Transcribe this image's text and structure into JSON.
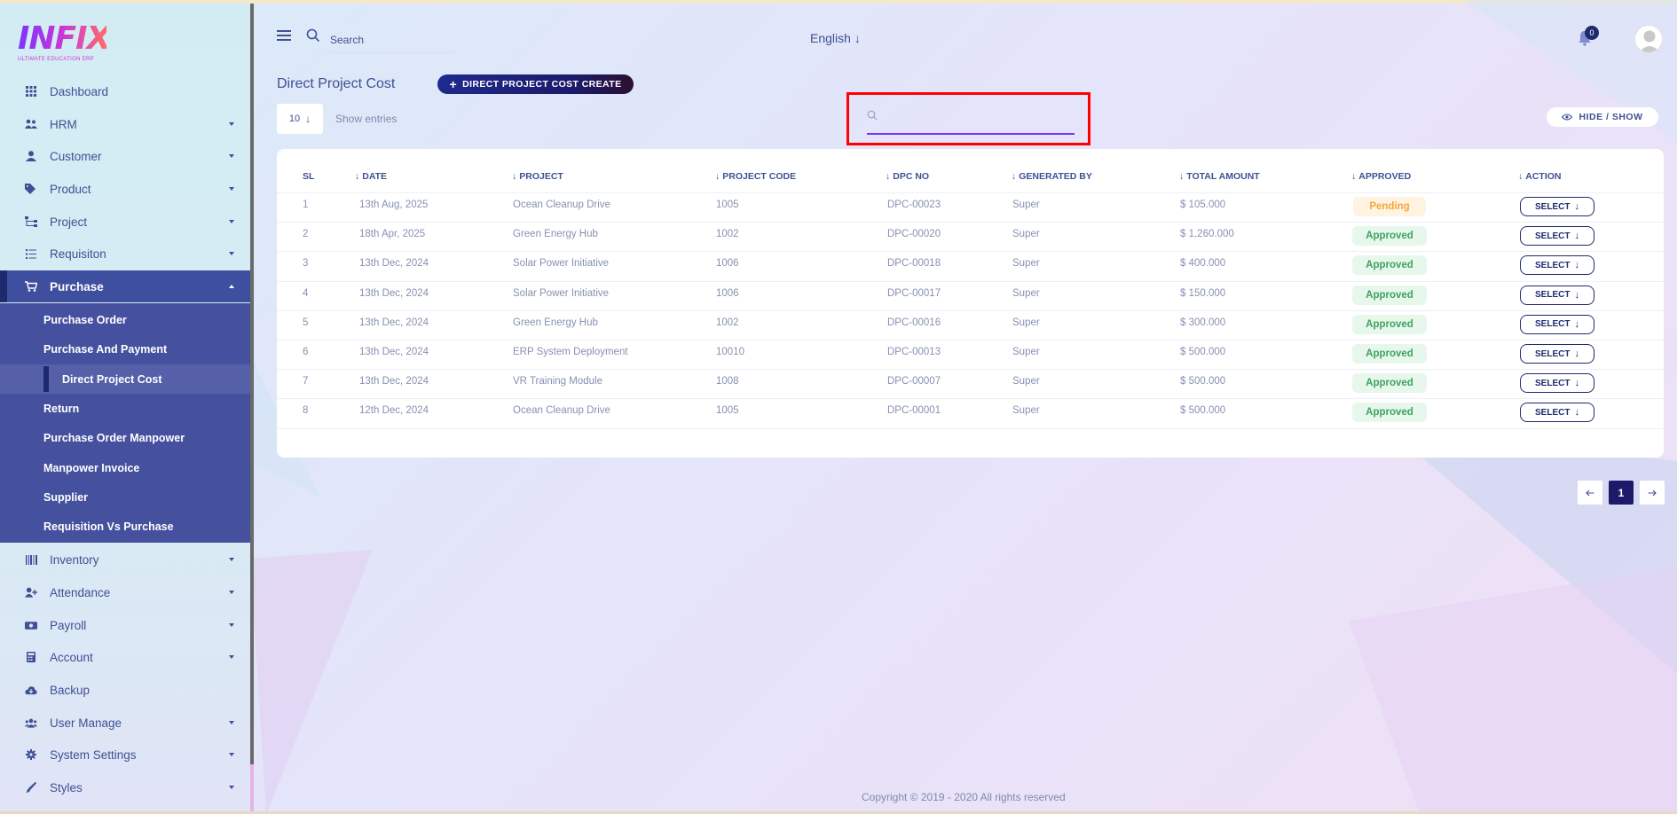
{
  "app": {
    "logo": "INFIX",
    "logo_sub": "ULTIMATE EDUCATION ERP"
  },
  "header": {
    "search_placeholder": "Search",
    "language": "English",
    "notification_count": "0"
  },
  "sidebar": {
    "items": [
      {
        "label": "Dashboard",
        "icon": "grid-icon"
      },
      {
        "label": "HRM",
        "icon": "people-icon"
      },
      {
        "label": "Customer",
        "icon": "user-icon"
      },
      {
        "label": "Product",
        "icon": "tags-icon"
      },
      {
        "label": "Project",
        "icon": "sitemap-icon"
      },
      {
        "label": "Requisiton",
        "icon": "list-icon"
      },
      {
        "label": "Purchase",
        "icon": "cart-icon"
      },
      {
        "label": "Inventory",
        "icon": "barcode-icon"
      },
      {
        "label": "Attendance",
        "icon": "user-plus-icon"
      },
      {
        "label": "Payroll",
        "icon": "money-icon"
      },
      {
        "label": "Account",
        "icon": "calculator-icon"
      },
      {
        "label": "Backup",
        "icon": "cloud-download-icon"
      },
      {
        "label": "User Manage",
        "icon": "users-icon"
      },
      {
        "label": "System Settings",
        "icon": "gear-icon"
      },
      {
        "label": "Styles",
        "icon": "brush-icon"
      }
    ],
    "purchase_submenu": [
      "Purchase Order",
      "Purchase And Payment",
      "Direct Project Cost",
      "Return",
      "Purchase Order Manpower",
      "Manpower Invoice",
      "Supplier",
      "Requisition Vs Purchase"
    ]
  },
  "page": {
    "title": "Direct Project Cost",
    "create_button": "DIRECT PROJECT COST CREATE",
    "entries_value": "10",
    "entries_label": "Show entries",
    "hide_show": "HIDE / SHOW"
  },
  "table": {
    "columns": [
      "SL",
      "DATE",
      "PROJECT",
      "PROJECT CODE",
      "DPC NO",
      "GENERATED BY",
      "TOTAL AMOUNT",
      "APPROVED",
      "ACTION"
    ],
    "rows": [
      {
        "sl": "1",
        "date": "13th Aug, 2025",
        "project": "Ocean Cleanup Drive",
        "code": "1005",
        "dpc": "DPC-00023",
        "by": "Super",
        "amount": "$ 105.000",
        "status": "Pending",
        "action": "SELECT"
      },
      {
        "sl": "2",
        "date": "18th Apr, 2025",
        "project": "Green Energy Hub",
        "code": "1002",
        "dpc": "DPC-00020",
        "by": "Super",
        "amount": "$ 1,260.000",
        "status": "Approved",
        "action": "SELECT"
      },
      {
        "sl": "3",
        "date": "13th Dec, 2024",
        "project": "Solar Power Initiative",
        "code": "1006",
        "dpc": "DPC-00018",
        "by": "Super",
        "amount": "$ 400.000",
        "status": "Approved",
        "action": "SELECT"
      },
      {
        "sl": "4",
        "date": "13th Dec, 2024",
        "project": "Solar Power Initiative",
        "code": "1006",
        "dpc": "DPC-00017",
        "by": "Super",
        "amount": "$ 150.000",
        "status": "Approved",
        "action": "SELECT"
      },
      {
        "sl": "5",
        "date": "13th Dec, 2024",
        "project": "Green Energy Hub",
        "code": "1002",
        "dpc": "DPC-00016",
        "by": "Super",
        "amount": "$ 300.000",
        "status": "Approved",
        "action": "SELECT"
      },
      {
        "sl": "6",
        "date": "13th Dec, 2024",
        "project": "ERP System Deployment",
        "code": "10010",
        "dpc": "DPC-00013",
        "by": "Super",
        "amount": "$ 500.000",
        "status": "Approved",
        "action": "SELECT"
      },
      {
        "sl": "7",
        "date": "13th Dec, 2024",
        "project": "VR Training Module",
        "code": "1008",
        "dpc": "DPC-00007",
        "by": "Super",
        "amount": "$ 500.000",
        "status": "Approved",
        "action": "SELECT"
      },
      {
        "sl": "8",
        "date": "12th Dec, 2024",
        "project": "Ocean Cleanup Drive",
        "code": "1005",
        "dpc": "DPC-00001",
        "by": "Super",
        "amount": "$ 500.000",
        "status": "Approved",
        "action": "SELECT"
      }
    ]
  },
  "pagination": {
    "current": "1"
  },
  "footer": "Copyright © 2019 - 2020 All rights reserved",
  "colors": {
    "primary": "#415094",
    "accent": "#7c32ff",
    "active_nav": "#3f4f9f",
    "pending": "#f7a638",
    "approved": "#3ca35f",
    "highlight": "#ff0000"
  }
}
